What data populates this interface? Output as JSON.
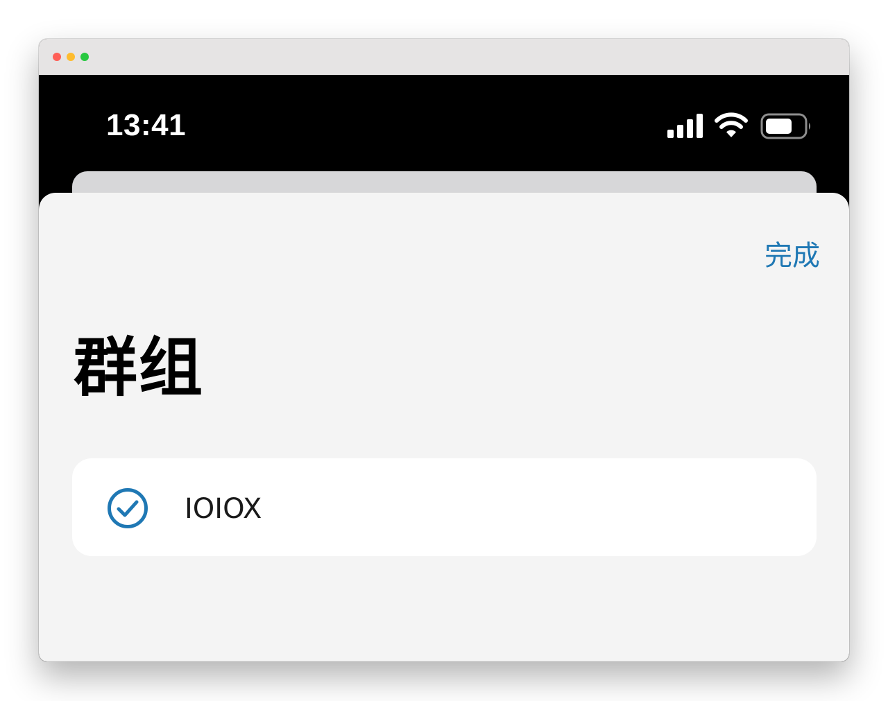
{
  "status_bar": {
    "time": "13:41"
  },
  "sheet": {
    "done_label": "完成",
    "title": "群组",
    "groups": [
      {
        "name": "IOIOX",
        "selected": true
      }
    ]
  },
  "icons": {
    "signal": "cellular-signal-icon",
    "wifi": "wifi-icon",
    "battery": "battery-icon",
    "check": "checkmark-circle-icon"
  },
  "colors": {
    "accent": "#1f78b4",
    "sheet_background": "#f4f4f4",
    "status_bar_background": "#000000"
  }
}
